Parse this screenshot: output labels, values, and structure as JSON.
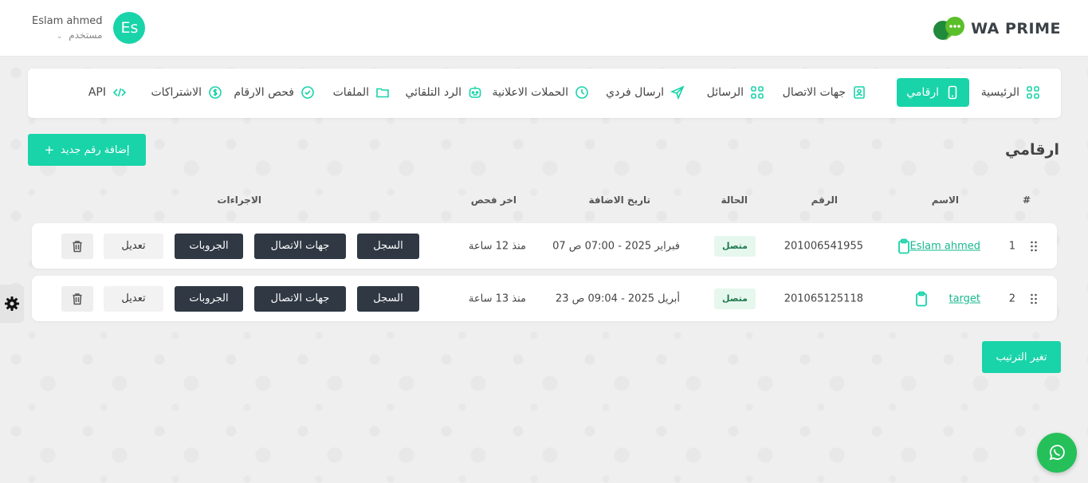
{
  "brand": {
    "name": "WA PRIME",
    "accent": "#19d3a9"
  },
  "user": {
    "name": "Eslam ahmed",
    "role": "مستخدم",
    "initials": "Es"
  },
  "nav": {
    "home": "الرئيسية",
    "numbers": "ارقامي",
    "contacts": "جهات الاتصال",
    "messages": "الرسائل",
    "single_send": "ارسال فردي",
    "campaigns": "الحملات الاعلانية",
    "autoreply": "الرد التلقائي",
    "files": "الملفات",
    "check_numbers": "فحص الارقام",
    "subscriptions": "الاشتراكات",
    "api": "API"
  },
  "page": {
    "title": "ارقامي",
    "add_button": "إضافة رقم جديد",
    "reorder_button": "تغير الترتيب"
  },
  "table": {
    "headers": {
      "index": "#",
      "name": "الاسم",
      "number": "الرقم",
      "status": "الحالة",
      "added_date": "تاريخ الاضافة",
      "last_check": "اخر فحص",
      "actions": "الاجراءات"
    },
    "rows": [
      {
        "index": "1",
        "name": "Eslam ahmed",
        "number": "201006541955",
        "status": "متصل",
        "added": "07 فبراير 2025 - 07:00 ص",
        "last_check": "منذ 12 ساعة",
        "log": "السجل",
        "contacts": "جهات الاتصال",
        "groups": "الجروبات",
        "edit": "تعديل"
      },
      {
        "index": "2",
        "name": "target",
        "number": "201065125118",
        "status": "متصل",
        "added": "23 أبريل 2025 - 09:04 ص",
        "last_check": "منذ 13 ساعة",
        "log": "السجل",
        "contacts": "جهات الاتصال",
        "groups": "الجروبات",
        "edit": "تعديل"
      }
    ]
  }
}
